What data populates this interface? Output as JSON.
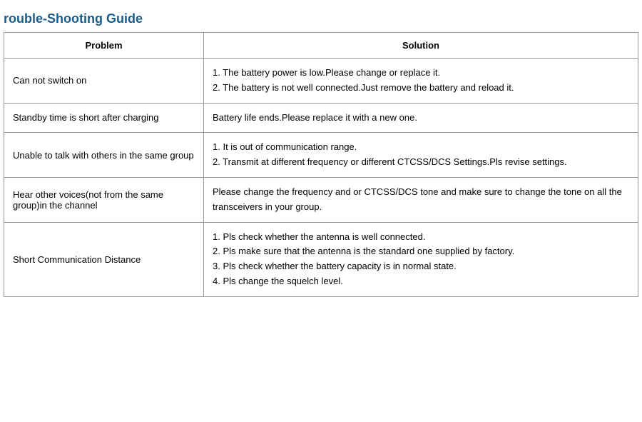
{
  "page": {
    "title": "rouble-Shooting Guide",
    "table": {
      "col_problem_header": "Problem",
      "col_solution_header": "Solution",
      "rows": [
        {
          "problem": "Can not switch on",
          "solution": "1. The battery power is low.Please change or replace it.\n2. The battery is not well connected.Just remove the battery and reload it."
        },
        {
          "problem": "Standby time is short after charging",
          "solution": "Battery life ends.Please replace it with a new one."
        },
        {
          "problem": "Unable to talk with others in the same group",
          "solution": "1. It is out of communication range.\n2. Transmit at different frequency or different CTCSS/DCS Settings.Pls revise settings."
        },
        {
          "problem": "Hear other voices(not from the same group)in the channel",
          "solution": "Please change the frequency and or CTCSS/DCS tone and make sure to change the tone on all the transceivers in your group."
        },
        {
          "problem": "Short Communication Distance",
          "solution": "1. Pls check whether the antenna is well connected.\n2. Pls make sure that the antenna is the standard one supplied by factory.\n3. Pls check whether the battery capacity is in normal state.\n4. Pls change the squelch level."
        }
      ]
    }
  }
}
